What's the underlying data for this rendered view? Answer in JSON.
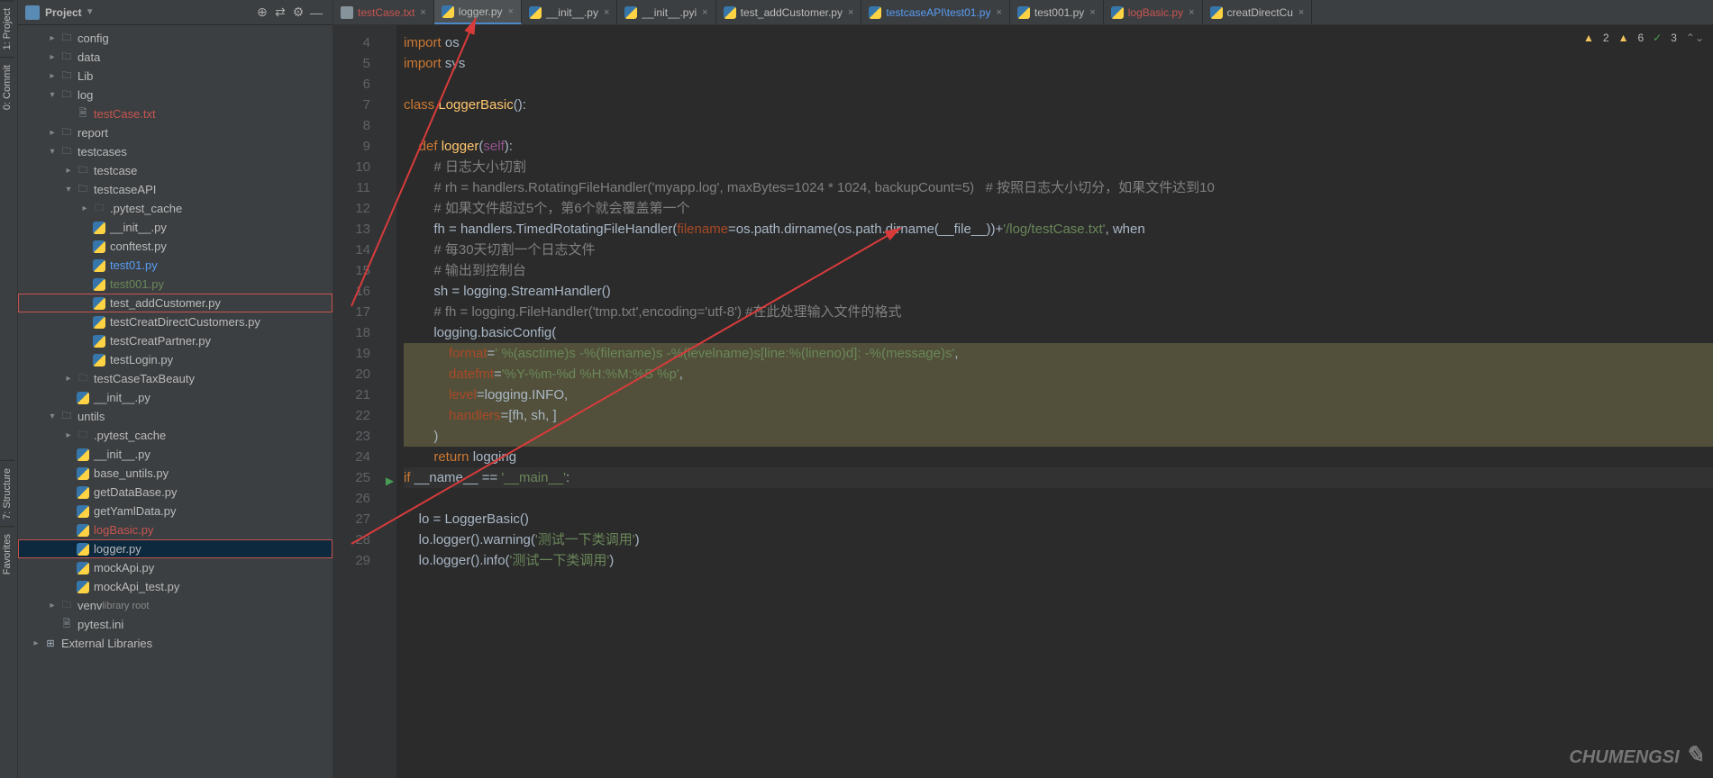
{
  "leftbar": {
    "project": "1: Project",
    "commit": "0: Commit",
    "structure": "7: Structure",
    "favorites": "Favorites"
  },
  "sidebar": {
    "title": "Project",
    "toolbar": {
      "locate": "⊕",
      "collapse": "⇄",
      "settings": "⚙",
      "hide": "—"
    },
    "tree": [
      {
        "indent": 1,
        "arrow": ">",
        "icon": "folder",
        "label": "config",
        "cls": ""
      },
      {
        "indent": 1,
        "arrow": ">",
        "icon": "folder",
        "label": "data",
        "cls": ""
      },
      {
        "indent": 1,
        "arrow": ">",
        "icon": "folder",
        "label": "Lib",
        "cls": ""
      },
      {
        "indent": 1,
        "arrow": "v",
        "icon": "folder",
        "label": "log",
        "cls": ""
      },
      {
        "indent": 2,
        "arrow": "",
        "icon": "txt",
        "label": "testCase.txt",
        "cls": "red"
      },
      {
        "indent": 1,
        "arrow": ">",
        "icon": "folder",
        "label": "report",
        "cls": ""
      },
      {
        "indent": 1,
        "arrow": "v",
        "icon": "folder",
        "label": "testcases",
        "cls": ""
      },
      {
        "indent": 2,
        "arrow": ">",
        "icon": "folder",
        "label": "testcase",
        "cls": ""
      },
      {
        "indent": 2,
        "arrow": "v",
        "icon": "folder",
        "label": "testcaseAPI",
        "cls": ""
      },
      {
        "indent": 3,
        "arrow": ">",
        "icon": "folder-d",
        "label": ".pytest_cache",
        "cls": "dim"
      },
      {
        "indent": 3,
        "arrow": "",
        "icon": "py",
        "label": "__init__.py",
        "cls": ""
      },
      {
        "indent": 3,
        "arrow": "",
        "icon": "py",
        "label": "conftest.py",
        "cls": ""
      },
      {
        "indent": 3,
        "arrow": "",
        "icon": "py",
        "label": "test01.py",
        "cls": "blue"
      },
      {
        "indent": 3,
        "arrow": "",
        "icon": "py",
        "label": "test001.py",
        "cls": "green"
      },
      {
        "indent": 3,
        "arrow": "",
        "icon": "py",
        "label": "test_addCustomer.py",
        "cls": "",
        "box": true
      },
      {
        "indent": 3,
        "arrow": "",
        "icon": "py",
        "label": "testCreatDirectCustomers.py",
        "cls": ""
      },
      {
        "indent": 3,
        "arrow": "",
        "icon": "py",
        "label": "testCreatPartner.py",
        "cls": ""
      },
      {
        "indent": 3,
        "arrow": "",
        "icon": "py",
        "label": "testLogin.py",
        "cls": ""
      },
      {
        "indent": 2,
        "arrow": ">",
        "icon": "folder-d",
        "label": "testCaseTaxBeauty",
        "cls": "dim"
      },
      {
        "indent": 2,
        "arrow": "",
        "icon": "py",
        "label": "__init__.py",
        "cls": ""
      },
      {
        "indent": 1,
        "arrow": "v",
        "icon": "folder",
        "label": "untils",
        "cls": ""
      },
      {
        "indent": 2,
        "arrow": ">",
        "icon": "folder-d",
        "label": ".pytest_cache",
        "cls": "dim"
      },
      {
        "indent": 2,
        "arrow": "",
        "icon": "py",
        "label": "__init__.py",
        "cls": ""
      },
      {
        "indent": 2,
        "arrow": "",
        "icon": "py",
        "label": "base_untils.py",
        "cls": ""
      },
      {
        "indent": 2,
        "arrow": "",
        "icon": "py",
        "label": "getDataBase.py",
        "cls": ""
      },
      {
        "indent": 2,
        "arrow": "",
        "icon": "py",
        "label": "getYamlData.py",
        "cls": ""
      },
      {
        "indent": 2,
        "arrow": "",
        "icon": "py",
        "label": "logBasic.py",
        "cls": "red"
      },
      {
        "indent": 2,
        "arrow": "",
        "icon": "py",
        "label": "logger.py",
        "cls": "",
        "box": true,
        "sel": true
      },
      {
        "indent": 2,
        "arrow": "",
        "icon": "py",
        "label": "mockApi.py",
        "cls": ""
      },
      {
        "indent": 2,
        "arrow": "",
        "icon": "py",
        "label": "mockApi_test.py",
        "cls": ""
      },
      {
        "indent": 1,
        "arrow": ">",
        "icon": "folder-d",
        "label": "venv",
        "extra": "library root",
        "cls": "dim"
      },
      {
        "indent": 1,
        "arrow": "",
        "icon": "txt",
        "label": "pytest.ini",
        "cls": ""
      },
      {
        "indent": 0,
        "arrow": ">",
        "icon": "lib",
        "label": "External Libraries",
        "cls": ""
      }
    ]
  },
  "tabs": [
    {
      "icon": "txt",
      "label": "testCase.txt",
      "cls": "red-text"
    },
    {
      "icon": "py",
      "label": "logger.py",
      "active": true
    },
    {
      "icon": "py",
      "label": "__init__.py"
    },
    {
      "icon": "py",
      "label": "__init__.pyi"
    },
    {
      "icon": "py",
      "label": "test_addCustomer.py"
    },
    {
      "icon": "py",
      "label": "testcaseAPI\\test01.py",
      "cls": "blue-text"
    },
    {
      "icon": "py",
      "label": "test001.py"
    },
    {
      "icon": "py",
      "label": "logBasic.py",
      "cls": "red-text"
    },
    {
      "icon": "py",
      "label": "creatDirectCu"
    }
  ],
  "status": {
    "warn_count": "2",
    "err_count": "6",
    "chk_count": "3"
  },
  "code": {
    "lines": [
      4,
      5,
      6,
      7,
      8,
      9,
      10,
      11,
      12,
      13,
      14,
      15,
      16,
      17,
      18,
      19,
      20,
      21,
      22,
      23,
      24,
      25,
      26,
      27,
      28,
      29
    ],
    "l4": "import os",
    "l5": "import sys",
    "l6": "",
    "l7_a": "class ",
    "l7_b": "LoggerBasic",
    "l7_c": "():",
    "l8": "",
    "l9_a": "    def ",
    "l9_b": "logger",
    "l9_c": "(",
    "l9_d": "self",
    "l9_e": "):",
    "l10": "        # 日志大小切割",
    "l11": "        # rh = handlers.RotatingFileHandler('myapp.log', maxBytes=1024 * 1024, backupCount=5)   # 按照日志大小切分，如果文件达到10",
    "l12": "        # 如果文件超过5个，第6个就会覆盖第一个",
    "l13_a": "        fh = handlers.TimedRotatingFileHandler(",
    "l13_b": "filename",
    "l13_c": "=os.path.dirname(os.path.dirname(__file__))+",
    "l13_d": "'/log/testCase.txt'",
    "l13_e": ", when",
    "l14": "        # 每30天切割一个日志文件",
    "l15": "        # 输出到控制台",
    "l16": "        sh = logging.StreamHandler()",
    "l17": "        # fh = logging.FileHandler('tmp.txt',encoding='utf-8') #在此处理输入文件的格式",
    "l18": "        logging.basicConfig(",
    "l19_a": "            ",
    "l19_b": "format",
    "l19_c": "=",
    "l19_d": "' %(asctime)s -%(filename)s -%(levelname)s[line:%(lineno)d]: -%(message)s'",
    "l19_e": ",",
    "l20_a": "            ",
    "l20_b": "datefmt",
    "l20_c": "=",
    "l20_d": "'%Y-%m-%d %H:%M:%S %p'",
    "l20_e": ",",
    "l21_a": "            ",
    "l21_b": "level",
    "l21_c": "=logging.INFO,",
    "l22_a": "            ",
    "l22_b": "handlers",
    "l22_c": "=[fh, sh, ]",
    "l23": "        )",
    "l24_a": "        return ",
    "l24_b": "logging",
    "l25_a": "if ",
    "l25_b": "__name__ == ",
    "l25_c": "'__main__'",
    "l25_d": ":",
    "l26": "",
    "l27": "    lo = LoggerBasic()",
    "l28_a": "    lo.logger().warning(",
    "l28_b": "'测试一下类调用'",
    "l28_c": ")",
    "l29_a": "    lo.logger().info(",
    "l29_b": "'测试一下类调用'",
    "l29_c": ")"
  },
  "watermark": "CHUMENGSI"
}
